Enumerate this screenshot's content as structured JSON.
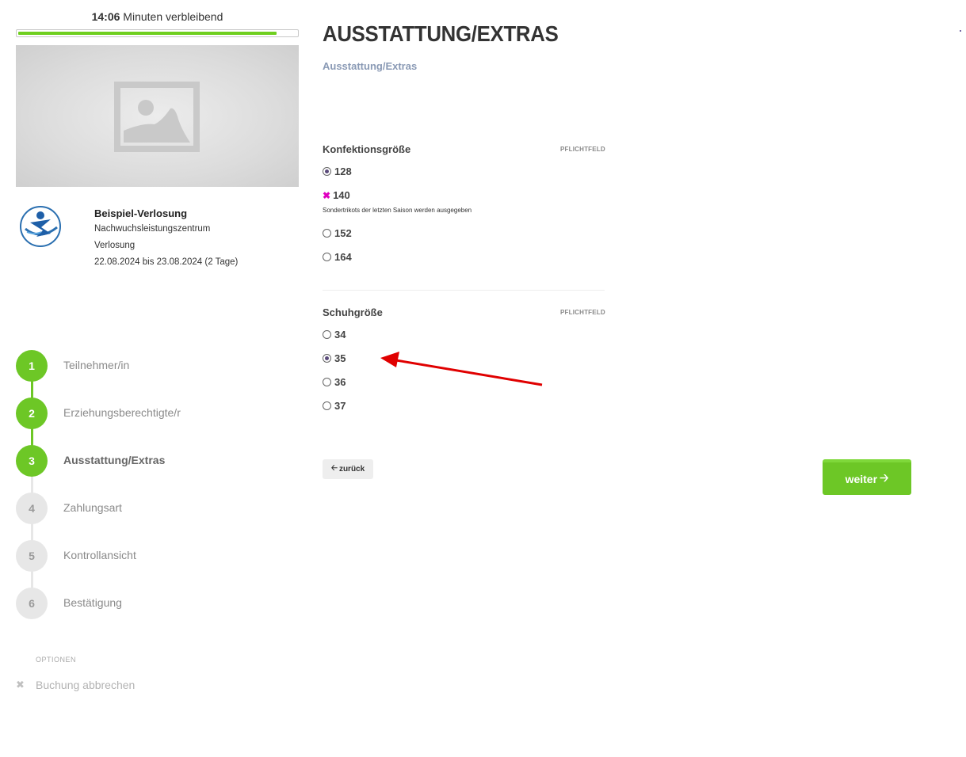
{
  "timer": {
    "minutes": "14:06",
    "suffix": " Minuten verbleibend",
    "progress": 0.93
  },
  "event": {
    "title": "Beispiel-Verlosung",
    "org": "Nachwuchsleistungszentrum",
    "type": "Verlosung",
    "dates": "22.08.2024 bis 23.08.2024 (2 Tage)"
  },
  "steps": [
    {
      "num": "1",
      "label": "Teilnehmer/in",
      "state": "done"
    },
    {
      "num": "2",
      "label": "Erziehungsberechtigte/r",
      "state": "done"
    },
    {
      "num": "3",
      "label": "Ausstattung/Extras",
      "state": "current"
    },
    {
      "num": "4",
      "label": "Zahlungsart",
      "state": "todo"
    },
    {
      "num": "5",
      "label": "Kontrollansicht",
      "state": "todo"
    },
    {
      "num": "6",
      "label": "Bestätigung",
      "state": "todo"
    }
  ],
  "options": {
    "title": "OPTIONEN",
    "cancel": "Buchung abbrechen"
  },
  "page": {
    "title": "AUSSTATTUNG/EXTRAS",
    "subtitle": "Ausstattung/Extras"
  },
  "clothing": {
    "label": "Konfektionsgröße",
    "required": "PFLICHTFELD",
    "options": [
      {
        "value": "128",
        "state": "selected"
      },
      {
        "value": "140",
        "state": "unavailable",
        "note": "Sondertrikots der letzten Saison werden ausgegeben"
      },
      {
        "value": "152",
        "state": "empty"
      },
      {
        "value": "164",
        "state": "empty"
      }
    ]
  },
  "shoes": {
    "label": "Schuhgröße",
    "required": "PFLICHTFELD",
    "options": [
      {
        "value": "34",
        "state": "empty"
      },
      {
        "value": "35",
        "state": "selected"
      },
      {
        "value": "36",
        "state": "empty"
      },
      {
        "value": "37",
        "state": "empty"
      }
    ]
  },
  "buttons": {
    "back": "zurück",
    "next": "weiter"
  },
  "colors": {
    "accent": "#6dc726",
    "arrow": "#e00000",
    "unavailable": "#e000c0"
  }
}
